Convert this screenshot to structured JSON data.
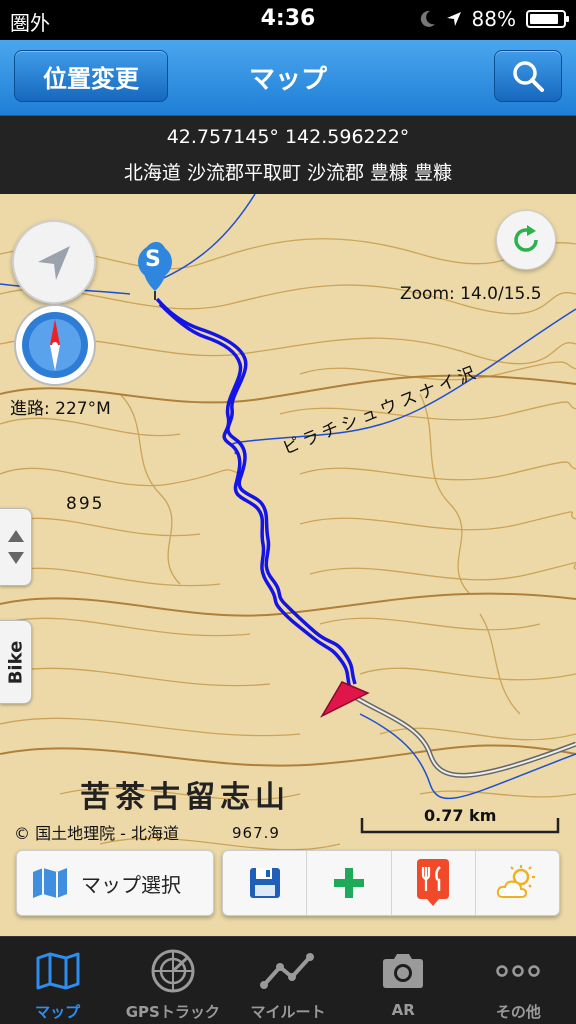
{
  "status_bar": {
    "carrier": "圏外",
    "time": "4:36",
    "battery_text": "88%",
    "battery_level": 0.88,
    "icons": [
      "moon-icon",
      "location-arrow-icon",
      "battery-icon"
    ]
  },
  "nav": {
    "left_button": "位置変更",
    "title": "マップ",
    "right_icon": "search-icon"
  },
  "location": {
    "coordinates": "42.757145° 142.596222°",
    "address": "北海道 沙流郡平取町 沙流郡 豊糠 豊糠"
  },
  "map": {
    "zoom": "Zoom: 14.0/15.5",
    "heading": "進路: 227°M",
    "copyright": "© 国土地理院 - 北海道",
    "scale": "0.77 km",
    "place_name": "苦茶古留志山",
    "elevation_label": "895",
    "elevation_label_2": "967.9",
    "river_label": "ピラチシュウスナイ沢",
    "start_marker": "S",
    "bike_tab": "Bike",
    "colors": {
      "track": "#1414e6",
      "position_marker": "#e0154a",
      "map_base": "#ecd9a7",
      "contour": "#c79a4a"
    }
  },
  "toolbar": {
    "map_select_label": "マップ選択",
    "tools": [
      "save-icon",
      "add-icon",
      "restaurant-icon",
      "weather-icon"
    ]
  },
  "tabbar": {
    "tabs": [
      {
        "label": "マップ",
        "icon": "map-icon",
        "active": true
      },
      {
        "label": "GPSトラック",
        "icon": "radar-icon",
        "active": false
      },
      {
        "label": "マイルート",
        "icon": "route-icon",
        "active": false
      },
      {
        "label": "AR",
        "icon": "camera-icon",
        "active": false
      },
      {
        "label": "その他",
        "icon": "more-icon",
        "active": false
      }
    ],
    "active_color": "#2d8ef0"
  }
}
